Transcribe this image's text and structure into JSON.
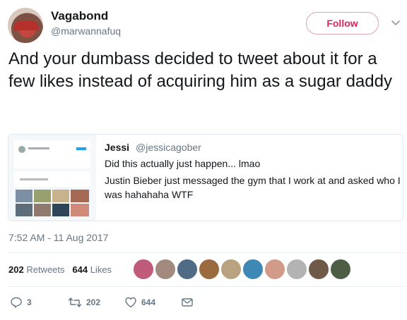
{
  "header": {
    "display_name": "Vagabond",
    "handle": "@marwannafuq",
    "follow_label": "Follow",
    "more_icon": "chevron-down-icon"
  },
  "tweet": {
    "text": "And your dumbass decided to tweet about it for a few likes instead of acquiring him as a sugar daddy"
  },
  "quoted_tweet": {
    "name": "Jessi",
    "handle": "@jessicagober",
    "line1": "Did this actually just happen... lmao",
    "line2": "Justin Bieber just messaged the gym that I work at and asked who I was hahahaha WTF"
  },
  "timestamp": "7:52 AM - 11 Aug 2017",
  "stats": {
    "retweets_count": "202",
    "retweets_label": "Retweets",
    "likes_count": "644",
    "likes_label": "Likes"
  },
  "liker_avatars": [
    "#c05b7a",
    "#a28a7f",
    "#4f6b86",
    "#9b6a3f",
    "#b9a27f",
    "#3d88b4",
    "#d29a88",
    "#b3b3b3",
    "#6f5a48",
    "#4d5e45"
  ],
  "actions": {
    "reply_count": "3",
    "retweet_count": "202",
    "like_count": "644"
  },
  "colors": {
    "follow_accent": "#e0245e",
    "secondary_text": "#657786"
  }
}
